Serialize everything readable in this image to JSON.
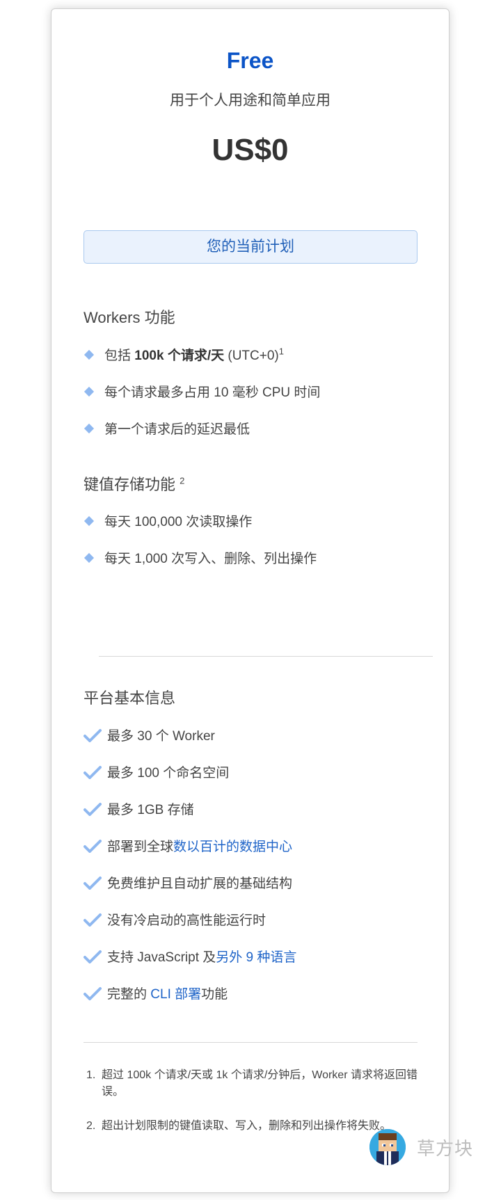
{
  "plan": {
    "name": "Free",
    "description": "用于个人用途和简单应用",
    "price": "US$0",
    "current_plan_label": "您的当前计划"
  },
  "workers_section": {
    "title": "Workers 功能",
    "features": [
      {
        "prefix": "包括 ",
        "bold": "100k 个请求/天",
        "suffix": " (UTC+0)",
        "sup": "1"
      },
      {
        "text": "每个请求最多占用 10 毫秒 CPU 时间"
      },
      {
        "text": "第一个请求后的延迟最低"
      }
    ]
  },
  "kv_section": {
    "title": "键值存储功能",
    "sup": "2",
    "features": [
      {
        "text": "每天 100,000 次读取操作"
      },
      {
        "text": "每天 1,000 次写入、删除、列出操作"
      }
    ]
  },
  "platform_section": {
    "title": "平台基本信息",
    "items": [
      {
        "text": "最多 30 个 Worker"
      },
      {
        "text": "最多 100 个命名空间"
      },
      {
        "text": "最多 1GB 存储"
      },
      {
        "prefix": "部署到全球",
        "link": "数以百计的数据中心",
        "suffix": ""
      },
      {
        "text": "免费维护且自动扩展的基础结构"
      },
      {
        "text": "没有冷启动的高性能运行时"
      },
      {
        "prefix": "支持 JavaScript 及",
        "link": "另外 9 种语言",
        "suffix": ""
      },
      {
        "prefix": "完整的 ",
        "link": "CLI 部署",
        "suffix": "功能"
      }
    ]
  },
  "footnotes": [
    {
      "num": "1.",
      "text": "超过 100k 个请求/天或 1k 个请求/分钟后，Worker 请求将返回错误。"
    },
    {
      "num": "2.",
      "text": "超出计划限制的键值读取、写入，删除和列出操作将失败。"
    }
  ],
  "watermark": {
    "text": "草方块"
  },
  "colors": {
    "accent": "#0b54c7",
    "link": "#1f64c8",
    "bullet": "#8fb8f0",
    "current_plan_bg": "#eaf2fd",
    "current_plan_border": "#a9c8ee"
  },
  "icons": {
    "feature_bullet": "diamond-icon",
    "platform_bullet": "checkmark-icon"
  }
}
